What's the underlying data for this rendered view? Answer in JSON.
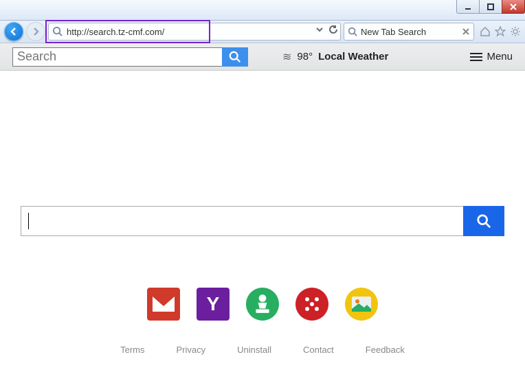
{
  "addressbar": {
    "url": "http://search.tz-cmf.com/"
  },
  "tab": {
    "title": "New Tab Search"
  },
  "toolbar": {
    "search_placeholder": "Search",
    "weather_temp": "98°",
    "weather_label": "Local Weather",
    "menu_label": "Menu"
  },
  "quicklinks": {
    "gmail": "Gmail",
    "yahoo": "Y",
    "games1": "Chess",
    "games2": "Dice",
    "photos": "Photos"
  },
  "footer": {
    "terms": "Terms",
    "privacy": "Privacy",
    "uninstall": "Uninstall",
    "contact": "Contact",
    "feedback": "Feedback"
  }
}
